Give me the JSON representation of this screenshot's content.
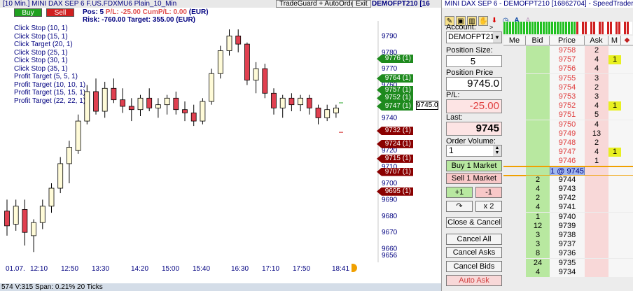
{
  "chart_window": {
    "title": "[10 Min.] MINI DAX SEP 6   F.US.FDXMU6 Plain_10_Min",
    "tradeguard_label": "TradeGuard + AutoOrder",
    "exit_label": "Exit",
    "account_label": "DEMOFPT210 [16",
    "buy_label": "Buy",
    "sell_label": "Sell",
    "pos_label": "Pos: 5",
    "pl_label": "P/L: -25.00",
    "cum_pl_label": "CumP/L: 0.00",
    "currency_label": "(EUR)",
    "risk_label": "Risk: -760.00  Target: 355.00 (EUR)",
    "click_items": [
      "Click Stop  (10, 1)",
      "Click Stop  (15, 1)",
      "Click Target  (20, 1)",
      "Click Stop  (25, 1)",
      "Click Stop  (30, 1)",
      "Click Stop  (35, 1)",
      "Profit Target  (5, 5, 1)",
      "Profit Target  (10, 10, 1)",
      "Profit Target  (15, 15, 1)",
      "Profit Target  (22, 22, 1)"
    ],
    "current_price_label": "9745.0",
    "orders": [
      {
        "label": "9776 (1)",
        "price": 9776,
        "kind": "target"
      },
      {
        "label": "9764 (1)",
        "price": 9764,
        "kind": "target"
      },
      {
        "label": "9757 (1)",
        "price": 9757,
        "kind": "target"
      },
      {
        "label": "9752 (1)",
        "price": 9752,
        "kind": "target"
      },
      {
        "label": "9747 (1)",
        "price": 9747,
        "kind": "target"
      },
      {
        "label": "9732 (1)",
        "price": 9732,
        "kind": "stop"
      },
      {
        "label": "9724 (1)",
        "price": 9724,
        "kind": "stop"
      },
      {
        "label": "9715 (1)",
        "price": 9715,
        "kind": "stop"
      },
      {
        "label": "9707 (1)",
        "price": 9707,
        "kind": "stop"
      },
      {
        "label": "9695 (1)",
        "price": 9695,
        "kind": "stop"
      }
    ],
    "status_bar": "574 V:315 Span: 0.21% 20 Ticks"
  },
  "chart_data": {
    "type": "candlestick",
    "y_ticks": [
      9790,
      9780,
      9770,
      9760,
      9750,
      9740,
      9720,
      9710,
      9700,
      9690,
      9680,
      9670,
      9660,
      9656
    ],
    "x_labels": [
      "01.07.",
      "12:10",
      "12:50",
      "13:30",
      "14:20",
      "15:00",
      "15:40",
      "16:30",
      "17:10",
      "17:50",
      "18:41"
    ],
    "ylim": [
      9653,
      9797
    ],
    "candles": [
      {
        "o": 9683,
        "h": 9690,
        "l": 9668,
        "c": 9674
      },
      {
        "o": 9675,
        "h": 9690,
        "l": 9671,
        "c": 9686
      },
      {
        "o": 9684,
        "h": 9690,
        "l": 9662,
        "c": 9670
      },
      {
        "o": 9668,
        "h": 9678,
        "l": 9658,
        "c": 9676
      },
      {
        "o": 9676,
        "h": 9690,
        "l": 9672,
        "c": 9686
      },
      {
        "o": 9686,
        "h": 9700,
        "l": 9682,
        "c": 9697
      },
      {
        "o": 9697,
        "h": 9716,
        "l": 9694,
        "c": 9712
      },
      {
        "o": 9712,
        "h": 9726,
        "l": 9700,
        "c": 9722
      },
      {
        "o": 9720,
        "h": 9742,
        "l": 9718,
        "c": 9738
      },
      {
        "o": 9738,
        "h": 9760,
        "l": 9736,
        "c": 9756
      },
      {
        "o": 9756,
        "h": 9764,
        "l": 9742,
        "c": 9744
      },
      {
        "o": 9744,
        "h": 9762,
        "l": 9740,
        "c": 9758
      },
      {
        "o": 9758,
        "h": 9764,
        "l": 9749,
        "c": 9751
      },
      {
        "o": 9751,
        "h": 9758,
        "l": 9743,
        "c": 9747
      },
      {
        "o": 9747,
        "h": 9752,
        "l": 9738,
        "c": 9745
      },
      {
        "o": 9745,
        "h": 9754,
        "l": 9741,
        "c": 9752
      },
      {
        "o": 9752,
        "h": 9758,
        "l": 9744,
        "c": 9746
      },
      {
        "o": 9746,
        "h": 9752,
        "l": 9740,
        "c": 9748
      },
      {
        "o": 9748,
        "h": 9754,
        "l": 9742,
        "c": 9752
      },
      {
        "o": 9752,
        "h": 9756,
        "l": 9742,
        "c": 9745
      },
      {
        "o": 9745,
        "h": 9750,
        "l": 9738,
        "c": 9743
      },
      {
        "o": 9743,
        "h": 9748,
        "l": 9735,
        "c": 9738
      },
      {
        "o": 9738,
        "h": 9752,
        "l": 9736,
        "c": 9750
      },
      {
        "o": 9750,
        "h": 9770,
        "l": 9748,
        "c": 9767
      },
      {
        "o": 9767,
        "h": 9784,
        "l": 9764,
        "c": 9781
      },
      {
        "o": 9781,
        "h": 9794,
        "l": 9778,
        "c": 9790
      },
      {
        "o": 9790,
        "h": 9794,
        "l": 9780,
        "c": 9785
      },
      {
        "o": 9785,
        "h": 9786,
        "l": 9760,
        "c": 9763
      },
      {
        "o": 9763,
        "h": 9774,
        "l": 9755,
        "c": 9770
      },
      {
        "o": 9770,
        "h": 9773,
        "l": 9752,
        "c": 9755
      },
      {
        "o": 9755,
        "h": 9758,
        "l": 9742,
        "c": 9746
      },
      {
        "o": 9746,
        "h": 9754,
        "l": 9740,
        "c": 9752
      },
      {
        "o": 9752,
        "h": 9755,
        "l": 9744,
        "c": 9748
      },
      {
        "o": 9748,
        "h": 9754,
        "l": 9744,
        "c": 9752
      },
      {
        "o": 9752,
        "h": 9754,
        "l": 9742,
        "c": 9746
      },
      {
        "o": 9746,
        "h": 9748,
        "l": 9736,
        "c": 9740
      },
      {
        "o": 9740,
        "h": 9748,
        "l": 9738,
        "c": 9745
      },
      {
        "o": 9743,
        "h": 9748,
        "l": 9740,
        "c": 9746
      }
    ],
    "colors": {
      "up": "#fffbd8",
      "down": "#e04050",
      "outline": "#000000"
    }
  },
  "speedtrader": {
    "title": "MINI DAX SEP 6  - DEMOFPT210 [16862704] - SpeedTrader",
    "account_label": "Account:",
    "account_value": "DEMOFPT21",
    "position_size_label": "Position Size:",
    "position_size_value": "5",
    "position_price_label": "Position Price",
    "position_price_value": "9745.0",
    "pl_label": "P/L:",
    "pl_value": "-25.00",
    "last_label": "Last:",
    "last_value": "9745",
    "order_volume_label": "Order Volume:",
    "order_volume_value": "1",
    "buy_market_label": "Buy 1 Market",
    "sell_market_label": "Sell 1 Market",
    "plus_one_label": "+1",
    "minus_one_label": "-1",
    "x2_label": "x 2",
    "close_cancel_label": "Close & Cancel",
    "cancel_all_label": "Cancel All",
    "cancel_asks_label": "Cancel Asks",
    "cancel_bids_label": "Cancel Bids",
    "auto_ask_label": "Auto Ask",
    "ladder_headers": [
      "Me",
      "Bid",
      "Price",
      "Ask",
      "M"
    ],
    "ladder_rows": [
      {
        "me": "",
        "bid": "",
        "price": "9758",
        "ask": "2",
        "m": "",
        "side": "ask"
      },
      {
        "me": "",
        "bid": "",
        "price": "9757",
        "ask": "4",
        "m": "1",
        "side": "ask"
      },
      {
        "me": "",
        "bid": "",
        "price": "9756",
        "ask": "4",
        "m": "",
        "side": "ask"
      },
      {
        "me": "",
        "bid": "",
        "price": "9755",
        "ask": "3",
        "m": "",
        "side": "ask"
      },
      {
        "me": "",
        "bid": "",
        "price": "9754",
        "ask": "2",
        "m": "",
        "side": "ask"
      },
      {
        "me": "",
        "bid": "",
        "price": "9753",
        "ask": "3",
        "m": "",
        "side": "ask"
      },
      {
        "me": "",
        "bid": "",
        "price": "9752",
        "ask": "4",
        "m": "1",
        "side": "ask"
      },
      {
        "me": "",
        "bid": "",
        "price": "9751",
        "ask": "5",
        "m": "",
        "side": "ask"
      },
      {
        "me": "",
        "bid": "",
        "price": "9750",
        "ask": "4",
        "m": "",
        "side": "ask"
      },
      {
        "me": "",
        "bid": "",
        "price": "9749",
        "ask": "13",
        "m": "",
        "side": "ask"
      },
      {
        "me": "",
        "bid": "",
        "price": "9748",
        "ask": "2",
        "m": "",
        "side": "ask"
      },
      {
        "me": "",
        "bid": "",
        "price": "9747",
        "ask": "4",
        "m": "1",
        "side": "ask"
      },
      {
        "me": "",
        "bid": "",
        "price": "9746",
        "ask": "1",
        "m": "",
        "side": "ask"
      },
      {
        "me": "",
        "bid": "",
        "price": "1 @  9745",
        "ask": "",
        "m": "",
        "side": "last"
      },
      {
        "me": "",
        "bid": "2",
        "price": "9744",
        "ask": "",
        "m": "",
        "side": "bid"
      },
      {
        "me": "",
        "bid": "4",
        "price": "9743",
        "ask": "",
        "m": "",
        "side": "bid"
      },
      {
        "me": "",
        "bid": "2",
        "price": "9742",
        "ask": "",
        "m": "",
        "side": "bid"
      },
      {
        "me": "",
        "bid": "4",
        "price": "9741",
        "ask": "",
        "m": "",
        "side": "bid"
      },
      {
        "me": "",
        "bid": "1",
        "price": "9740",
        "ask": "",
        "m": "",
        "side": "bid"
      },
      {
        "me": "",
        "bid": "12",
        "price": "9739",
        "ask": "",
        "m": "",
        "side": "bid"
      },
      {
        "me": "",
        "bid": "3",
        "price": "9738",
        "ask": "",
        "m": "",
        "side": "bid"
      },
      {
        "me": "",
        "bid": "3",
        "price": "9737",
        "ask": "",
        "m": "",
        "side": "bid"
      },
      {
        "me": "",
        "bid": "8",
        "price": "9736",
        "ask": "",
        "m": "",
        "side": "bid"
      },
      {
        "me": "",
        "bid": "24",
        "price": "9735",
        "ask": "",
        "m": "",
        "side": "bid"
      },
      {
        "me": "",
        "bid": "4",
        "price": "9734",
        "ask": "",
        "m": "",
        "side": "bid"
      }
    ],
    "colors": {
      "bid_bg": "#b8e8a0",
      "ask_bg": "#f8d8d8",
      "marker": "#e8f020",
      "last": "#a0b8f0"
    }
  }
}
